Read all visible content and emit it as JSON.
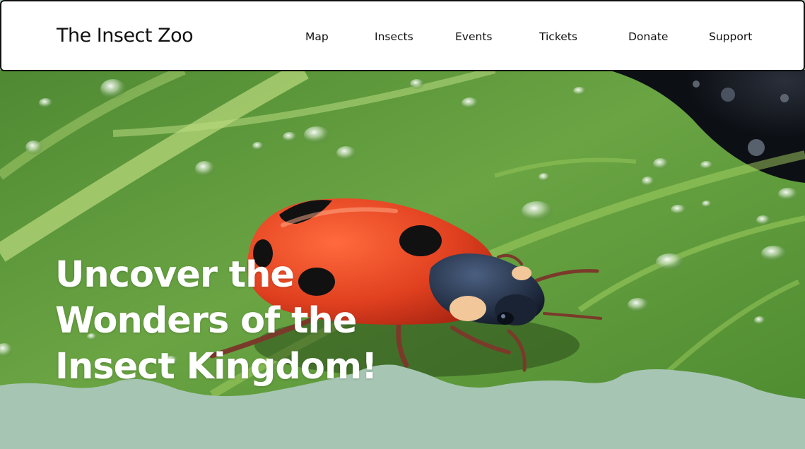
{
  "header": {
    "brand": "The Insect Zoo",
    "nav": [
      {
        "label": "Map"
      },
      {
        "label": "Insects"
      },
      {
        "label": "Events"
      },
      {
        "label": "Tickets"
      },
      {
        "label": "Donate"
      },
      {
        "label": "Support"
      }
    ]
  },
  "hero": {
    "headline_lines": [
      "Uncover the",
      "Wonders of the",
      "Insect Kingdom!"
    ],
    "image_subject": "red-ladybug-on-wet-leaf"
  },
  "colors": {
    "header_bg": "#ffffff",
    "text_dark": "#111111",
    "leaf_green": "#5f9a3c",
    "ladybug_red": "#e0401f",
    "wave_mint": "#a6c6b3",
    "headline": "#ffffff"
  }
}
